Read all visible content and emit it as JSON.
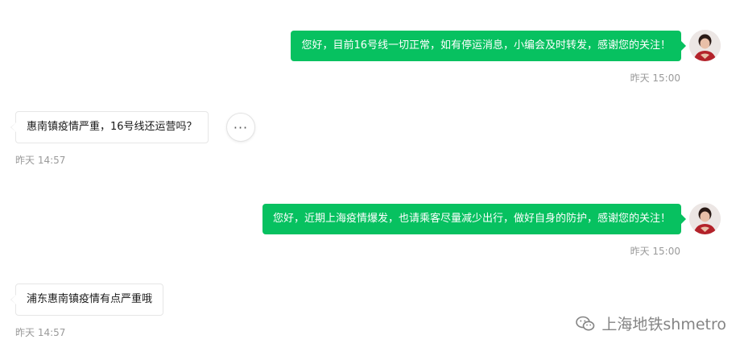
{
  "messages": [
    {
      "direction": "outgoing",
      "text": "您好，目前16号线一切正常，如有停运消息，小编会及时转发，感谢您的关注！",
      "time": "昨天 15:00"
    },
    {
      "direction": "incoming",
      "text": "惠南镇疫情严重，16号线还运营吗？",
      "time": "昨天 14:57"
    },
    {
      "direction": "outgoing",
      "text": "您好，近期上海疫情爆发，也请乘客尽量减少出行，做好自身的防护，感谢您的关注！",
      "time": "昨天 15:00"
    },
    {
      "direction": "incoming",
      "text": "浦东惠南镇疫情有点严重哦",
      "time": "昨天 14:57"
    }
  ],
  "more_button": {
    "icon": "ellipsis-icon",
    "label": "···"
  },
  "watermark": {
    "icon": "wechat-icon",
    "text": "上海地铁shmetro"
  },
  "colors": {
    "outgoing_bubble": "#07c160",
    "incoming_border": "#e6e6e6",
    "timestamp": "#9a9a9a"
  }
}
